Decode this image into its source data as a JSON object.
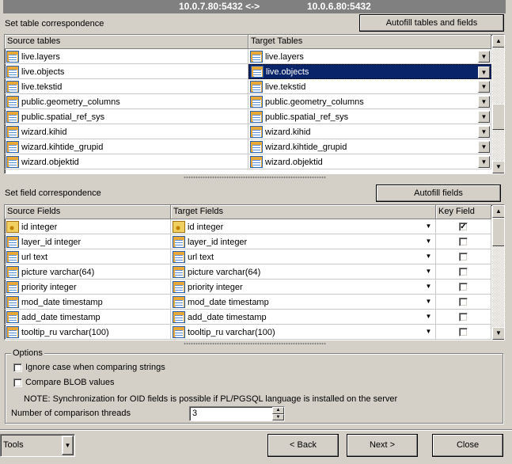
{
  "title": {
    "left": "10.0.7.80:5432 <->",
    "right": "10.0.6.80:5432"
  },
  "tables": {
    "section_label": "Set table correspondence",
    "autofill_label": "Autofill tables and fields",
    "col_source": "Source tables",
    "col_target": "Target Tables",
    "rows": [
      {
        "source": "live.layers",
        "target": "live.layers"
      },
      {
        "source": "live.objects",
        "target": "live.objects"
      },
      {
        "source": "live.tekstid",
        "target": "live.tekstid"
      },
      {
        "source": "public.geometry_columns",
        "target": "public.geometry_columns"
      },
      {
        "source": "public.spatial_ref_sys",
        "target": "public.spatial_ref_sys"
      },
      {
        "source": "wizard.kihid",
        "target": "wizard.kihid"
      },
      {
        "source": "wizard.kihtide_grupid",
        "target": "wizard.kihtide_grupid"
      },
      {
        "source": "wizard.objektid",
        "target": "wizard.objektid"
      }
    ],
    "selected_row": 1
  },
  "fields": {
    "section_label": "Set field correspondence",
    "autofill_label": "Autofill fields",
    "col_source": "Source Fields",
    "col_target": "Target Fields",
    "col_key": "Key Field",
    "rows": [
      {
        "source": "id integer",
        "target": "id integer",
        "key": true
      },
      {
        "source": "layer_id integer",
        "target": "layer_id integer",
        "key": false
      },
      {
        "source": "url text",
        "target": "url text",
        "key": false
      },
      {
        "source": "picture varchar(64)",
        "target": "picture varchar(64)",
        "key": false
      },
      {
        "source": "priority integer",
        "target": "priority integer",
        "key": false
      },
      {
        "source": "mod_date timestamp",
        "target": "mod_date timestamp",
        "key": false
      },
      {
        "source": "add_date timestamp",
        "target": "add_date timestamp",
        "key": false
      },
      {
        "source": "tooltip_ru varchar(100)",
        "target": "tooltip_ru varchar(100)",
        "key": false
      }
    ]
  },
  "options": {
    "legend": "Options",
    "ignore_case": "Ignore case when comparing strings",
    "compare_blob": "Compare BLOB values",
    "note": "NOTE: Synchronization for OID fields is possible if PL/PGSQL language is installed on the server",
    "threads_label": "Number of comparison threads",
    "threads_value": "3"
  },
  "footer": {
    "tools_label": "Tools",
    "back_label": "Back",
    "next_label": "Next >",
    "close_label": "Close"
  }
}
